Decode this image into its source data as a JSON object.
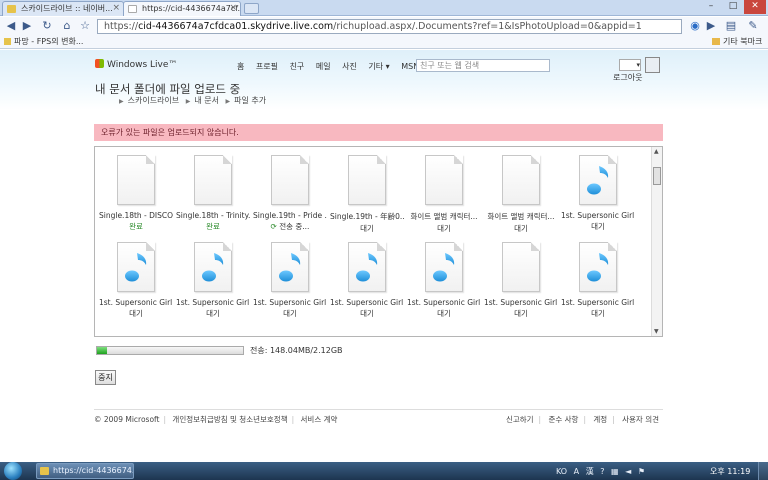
{
  "browser": {
    "tabs": [
      {
        "label": "스카이드라이브 :: 네이버..."
      },
      {
        "label": "https://cid-4436674a7cf..."
      }
    ],
    "url_scheme": "https://",
    "url_host": "cid-4436674a7cfdca01.skydrive.live.com",
    "url_path": "/richupload.aspx/.Documents?ref=1&IsPhotoUpload=0&appid=1",
    "bookmark_left": "파망 - FPS의 변화...",
    "bookmark_right": "기타 북마크"
  },
  "site": {
    "logo": "Windows Live™",
    "nav": [
      "홈",
      "프로필",
      "친구",
      "메일",
      "사진",
      "기타 ▾",
      "MSN ▾"
    ],
    "search_placeholder": "친구 또는 웹 검색",
    "search_brand": "bing",
    "logout": "로그아웃"
  },
  "page": {
    "title": "내 문서 폴더에 파일 업로드 중",
    "breadcrumb": [
      "스카이드라이브",
      "내 문서",
      "파일 추가"
    ],
    "error_message": "오류가 있는 파일은 업로드되지 않습니다."
  },
  "files": [
    {
      "name": "Single.18th - DISCO...",
      "status": "완료",
      "type": "document",
      "state": "done"
    },
    {
      "name": "Single.18th - Trinity...",
      "status": "완료",
      "type": "document",
      "state": "done"
    },
    {
      "name": "Single.19th - Pride ...",
      "status": "전송 중...",
      "type": "document",
      "state": "busy"
    },
    {
      "name": "Single.19th - 年齢0...",
      "status": "대기",
      "type": "document",
      "state": "waiting"
    },
    {
      "name": "화이트 앨범 캐릭터...",
      "status": "대기",
      "type": "document",
      "state": "waiting"
    },
    {
      "name": "화이트 앨범 캐릭터...",
      "status": "대기",
      "type": "document",
      "state": "waiting"
    },
    {
      "name": "1st. Supersonic Girl ...",
      "status": "대기",
      "type": "music",
      "state": "waiting"
    },
    {
      "name": "1st. Supersonic Girl ...",
      "status": "대기",
      "type": "music",
      "state": "waiting"
    },
    {
      "name": "1st. Supersonic Girl ...",
      "status": "대기",
      "type": "music",
      "state": "waiting"
    },
    {
      "name": "1st. Supersonic Girl ...",
      "status": "대기",
      "type": "music",
      "state": "waiting"
    },
    {
      "name": "1st. Supersonic Girl ...",
      "status": "대기",
      "type": "music",
      "state": "waiting"
    },
    {
      "name": "1st. Supersonic Girl ...",
      "status": "대기",
      "type": "music",
      "state": "waiting"
    },
    {
      "name": "1st. Supersonic Girl ...",
      "status": "대기",
      "type": "document",
      "state": "waiting"
    },
    {
      "name": "1st. Supersonic Girl ...",
      "status": "대기",
      "type": "music",
      "state": "waiting"
    }
  ],
  "progress": {
    "fraction": 0.07,
    "label": "전송: 148.04MB/2.12GB"
  },
  "stop_button": "중지",
  "footer": {
    "left": [
      "© 2009 Microsoft",
      "개인정보취급방침 및 청소년보호정책",
      "서비스 계약"
    ],
    "right": [
      "신고하기",
      "준수 사항",
      "계정",
      "사용자 의견"
    ]
  },
  "taskbar": {
    "item": "https://cid-4436674...",
    "tray": [
      "KO",
      "A",
      "漢",
      "?"
    ],
    "clock": "오후 11:19"
  },
  "colors": {
    "error_bg": "#f8b8c0",
    "progress_fill": "#1ea21e",
    "music_icon": "#1f8fd8",
    "done_status": "#2a8a2a"
  }
}
